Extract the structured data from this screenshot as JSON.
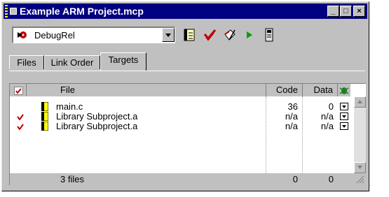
{
  "window": {
    "title": "Example ARM Project.mcp"
  },
  "toolbar": {
    "target": "DebugRel"
  },
  "tabs": [
    {
      "label": "Files"
    },
    {
      "label": "Link Order"
    },
    {
      "label": "Targets"
    }
  ],
  "columns": {
    "file": "File",
    "code": "Code",
    "data": "Data"
  },
  "rows": [
    {
      "checked": false,
      "name": "main.c",
      "code": "36",
      "data": "0"
    },
    {
      "checked": true,
      "name": "Library Subproject.a",
      "code": "n/a",
      "data": "n/a"
    },
    {
      "checked": true,
      "name": "Library Subproject.a",
      "code": "n/a",
      "data": "n/a"
    }
  ],
  "footer": {
    "count": "3 files",
    "code_total": "0",
    "data_total": "0"
  },
  "colors": {
    "titlebar": "#000080",
    "checkmark": "#c00000",
    "play": "#00a000"
  }
}
